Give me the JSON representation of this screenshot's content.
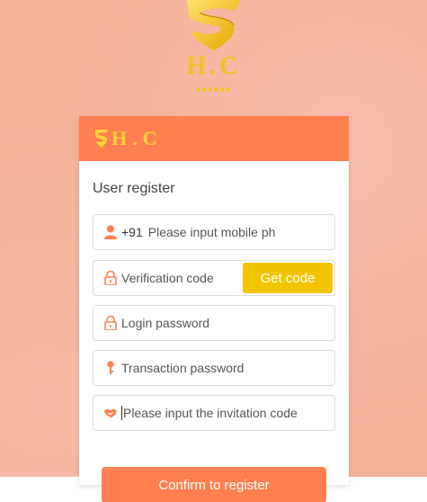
{
  "logo": {
    "text": "H.C",
    "subtext": "■■■■■■"
  },
  "card": {
    "header_logo_text": "H.C",
    "title": "User register"
  },
  "form": {
    "mobile": {
      "prefix": "+91",
      "placeholder": "Please input mobile ph"
    },
    "verification": {
      "placeholder": "Verification code",
      "button": "Get code"
    },
    "login_password": {
      "placeholder": "Login password"
    },
    "transaction_password": {
      "placeholder": "Transaction password"
    },
    "invitation": {
      "placeholder": "Please input the invitation code"
    }
  },
  "confirm_label": "Confirm to register",
  "colors": {
    "accent": "#ff7f50",
    "gold": "#f0c400",
    "background": "#f5b19a"
  },
  "icons": [
    "user-icon",
    "lock-icon",
    "lock-icon",
    "key-icon",
    "handshake-icon"
  ]
}
